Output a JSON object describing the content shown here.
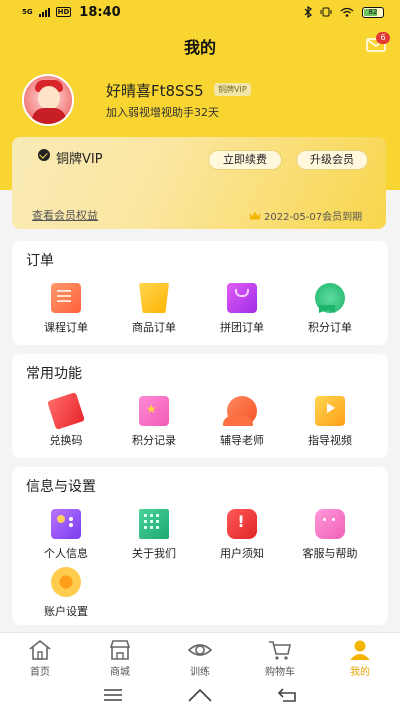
{
  "status_bar": {
    "network": "5G",
    "hd": "HD",
    "time": "18:40",
    "battery": "82"
  },
  "header": {
    "title": "我的",
    "message_badge": "6"
  },
  "profile": {
    "username": "好晴喜Ft8SS5",
    "vip_tag": "铜牌VIP",
    "subtitle": "加入弱视增视助手32天"
  },
  "vip_card": {
    "title": "铜牌VIP",
    "renew_label": "立即续费",
    "upgrade_label": "升级会员",
    "benefits_link": "查看会员权益",
    "expire_text": "2022-05-07会员到期"
  },
  "orders": {
    "title": "订单",
    "items": [
      {
        "label": "课程订单",
        "icon": "course-order-icon"
      },
      {
        "label": "商品订单",
        "icon": "cart-icon"
      },
      {
        "label": "拼团订单",
        "icon": "group-bag-icon"
      },
      {
        "label": "积分订单",
        "icon": "medal-icon"
      }
    ]
  },
  "common": {
    "title": "常用功能",
    "items": [
      {
        "label": "兑换码",
        "icon": "ticket-icon"
      },
      {
        "label": "积分记录",
        "icon": "points-icon"
      },
      {
        "label": "辅导老师",
        "icon": "teacher-icon"
      },
      {
        "label": "指导视频",
        "icon": "video-icon"
      }
    ]
  },
  "settings": {
    "title": "信息与设置",
    "items": [
      {
        "label": "个人信息",
        "icon": "id-card-icon"
      },
      {
        "label": "关于我们",
        "icon": "building-icon"
      },
      {
        "label": "用户须知",
        "icon": "alert-icon"
      },
      {
        "label": "客服与帮助",
        "icon": "chat-icon"
      },
      {
        "label": "账户设置",
        "icon": "flower-gear-icon"
      }
    ]
  },
  "bottom_nav": {
    "items": [
      {
        "label": "首页",
        "icon": "home-icon"
      },
      {
        "label": "商城",
        "icon": "shop-icon"
      },
      {
        "label": "训练",
        "icon": "eye-icon"
      },
      {
        "label": "购物车",
        "icon": "cart-outline-icon"
      },
      {
        "label": "我的",
        "icon": "user-icon",
        "active": true
      }
    ]
  },
  "colors": {
    "brand_yellow": "#f8d531",
    "active_nav": "#e6a400",
    "badge_red": "#e53935"
  }
}
